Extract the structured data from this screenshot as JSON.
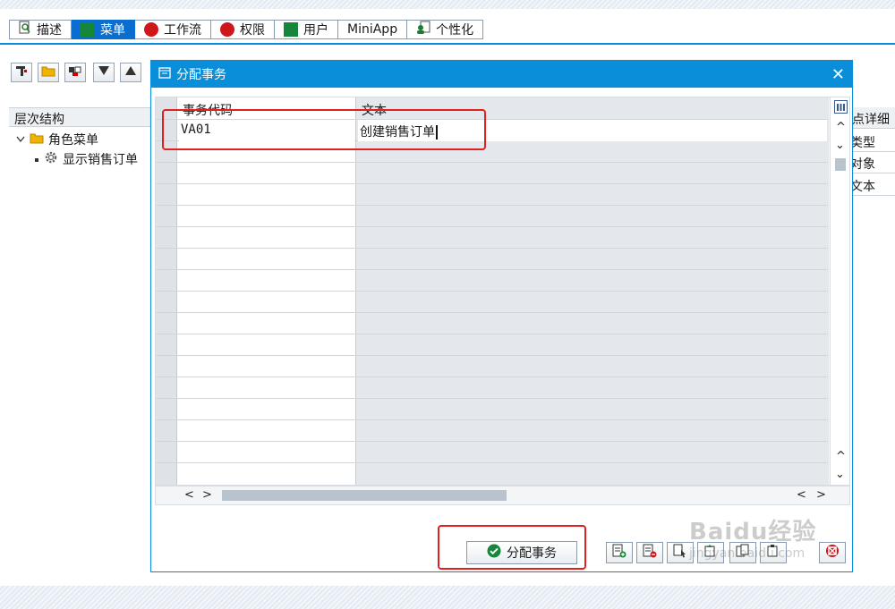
{
  "tabs": [
    {
      "label": "描述",
      "icon": "magnifier-doc-icon"
    },
    {
      "label": "菜单",
      "icon": "green-square-icon",
      "active": true
    },
    {
      "label": "工作流",
      "icon": "red-dot-icon"
    },
    {
      "label": "权限",
      "icon": "red-dot-icon"
    },
    {
      "label": "用户",
      "icon": "green-square-icon"
    },
    {
      "label": "MiniApp",
      "icon": ""
    },
    {
      "label": "个性化",
      "icon": "person-doc-icon"
    }
  ],
  "hierarchy": {
    "header": "层次结构",
    "root": "角色菜单",
    "child": "显示销售订单"
  },
  "detail": {
    "header": "节点详细",
    "rows": [
      "类型",
      "对象",
      "文本"
    ]
  },
  "dialog": {
    "title": "分配事务",
    "columns": [
      "事务代码",
      "文本"
    ],
    "row": {
      "code": "VA01",
      "text": "创建销售订单"
    },
    "assign_button": "分配事务"
  },
  "colors": {
    "accent": "#0a8ed9",
    "active_tab": "#0a6ed1",
    "highlight": "#e02020",
    "ok_green": "#16873a"
  },
  "watermark": {
    "line1": "Baidu经验",
    "line2": "jingyan.baidu.com"
  }
}
